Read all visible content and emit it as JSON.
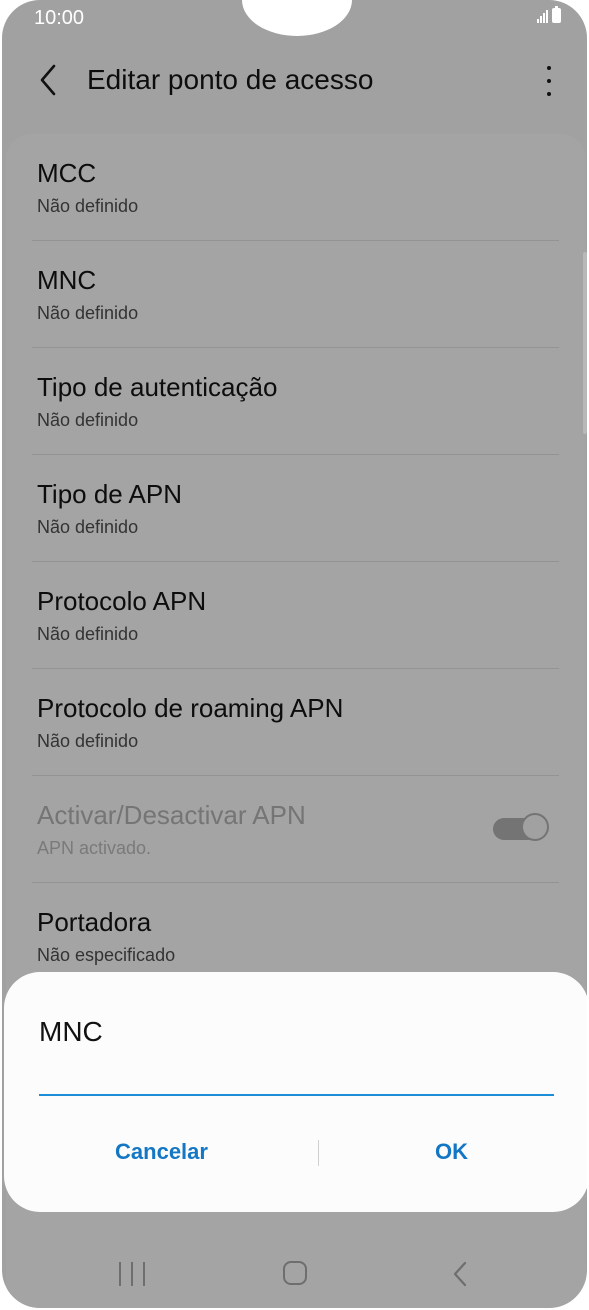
{
  "status_bar": {
    "time": "10:00"
  },
  "app_bar": {
    "title": "Editar ponto de acesso"
  },
  "settings": [
    {
      "title": "MCC",
      "subtitle": "Não definido"
    },
    {
      "title": "MNC",
      "subtitle": "Não definido"
    },
    {
      "title": "Tipo de autenticação",
      "subtitle": "Não definido"
    },
    {
      "title": "Tipo de APN",
      "subtitle": "Não definido"
    },
    {
      "title": "Protocolo APN",
      "subtitle": "Não definido"
    },
    {
      "title": "Protocolo de roaming APN",
      "subtitle": "Não definido"
    },
    {
      "title": "Activar/Desactivar APN",
      "subtitle": "APN activado.",
      "toggle_on": true,
      "enabled": false
    },
    {
      "title": "Portadora",
      "subtitle": "Não especificado"
    }
  ],
  "dialog": {
    "title": "MNC",
    "input_value": "",
    "cancel_label": "Cancelar",
    "ok_label": "OK"
  },
  "colors": {
    "accent": "#1c8ed8",
    "button_text": "#1377c5",
    "overlay_background": "#a1a1a1",
    "dialog_background": "#fcfcfc"
  },
  "icons": [
    "back-arrow-icon",
    "more-options-icon",
    "signal-icon",
    "battery-icon",
    "recent-apps-icon",
    "home-icon",
    "nav-back-icon"
  ]
}
